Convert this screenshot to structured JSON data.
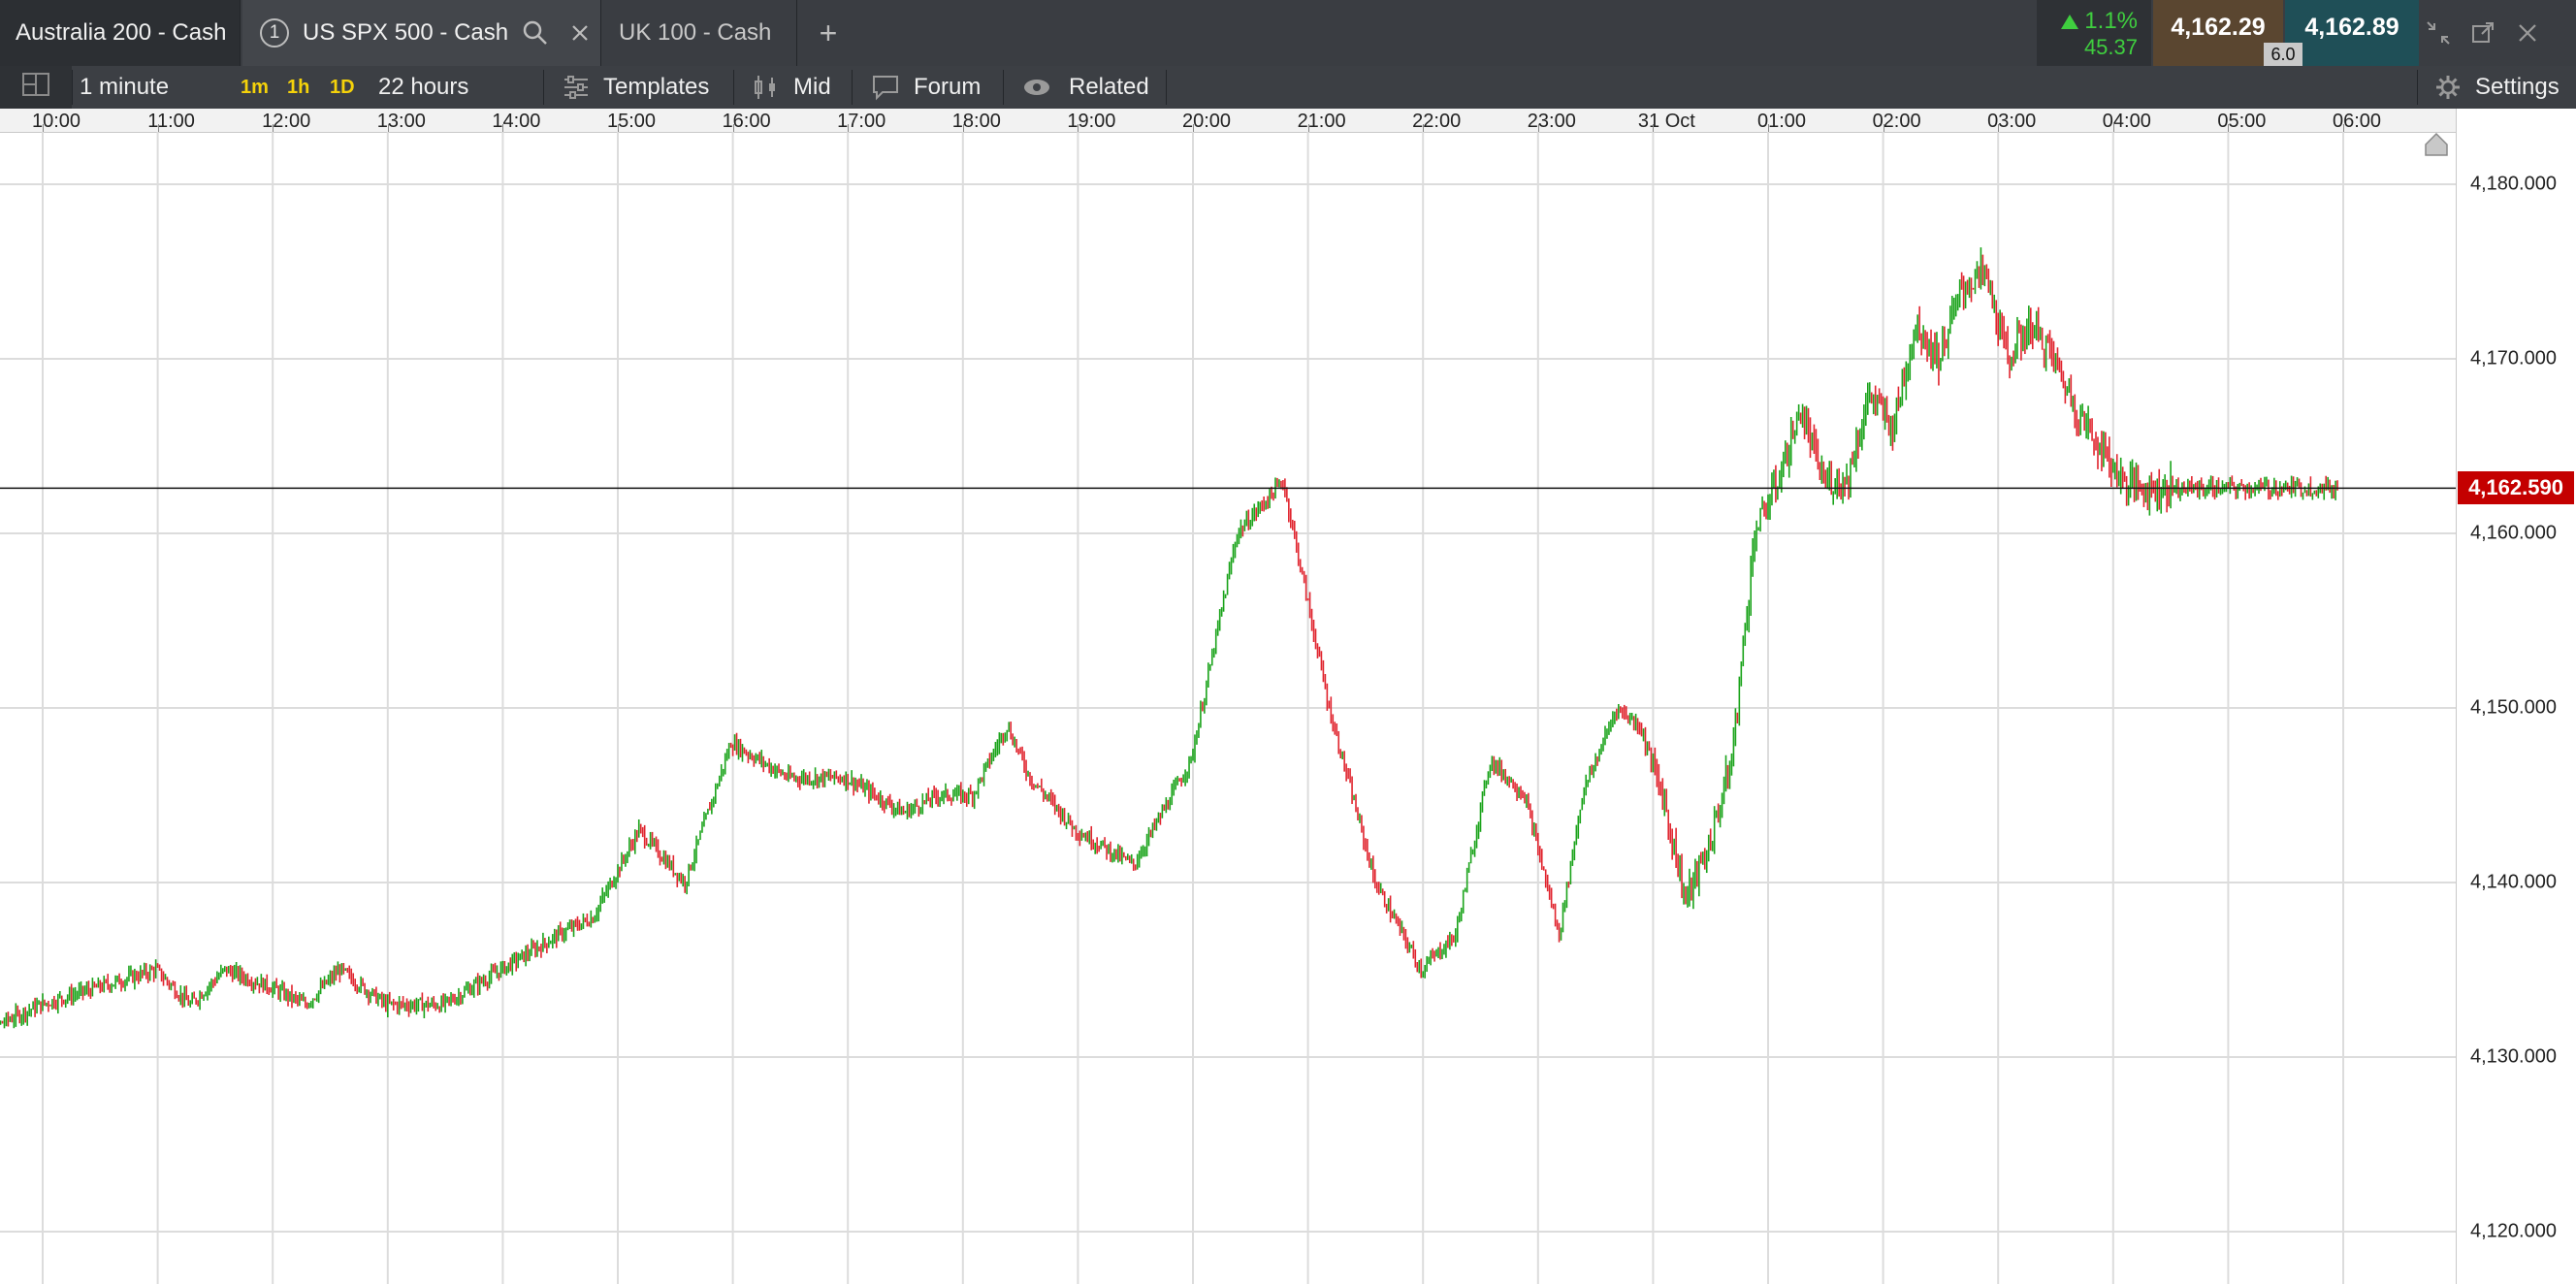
{
  "tabs": [
    {
      "label": "Australia 200 - Cash"
    },
    {
      "label": "US SPX 500 - Cash",
      "number": "1"
    },
    {
      "label": "UK 100 - Cash"
    }
  ],
  "add_tab_label": "+",
  "quote": {
    "change_pct": "1.1%",
    "change_abs": "45.37",
    "sell": "4,162.29",
    "buy": "4,162.89",
    "spread": "6.0",
    "colors": {
      "up": "#3fce3f",
      "sell_bg": "#5a4630",
      "buy_bg": "#1f4f57",
      "current_price_bg": "#c40000"
    }
  },
  "toolbar": {
    "interval": "1 minute",
    "tf_1m": "1m",
    "tf_1h": "1h",
    "tf_1d": "1D",
    "range": "22 hours",
    "templates": "Templates",
    "price_type": "Mid",
    "forum": "Forum",
    "related": "Related",
    "settings": "Settings"
  },
  "icons": [
    "layout-icon",
    "search-icon",
    "close-icon",
    "templates-icon",
    "candlestick-icon",
    "chat-icon",
    "eye-icon",
    "gear-icon",
    "collapse-icon",
    "popout-icon",
    "close-window-icon"
  ],
  "chart_data": {
    "type": "line",
    "style": "candlestick",
    "x_labels": [
      "10:00",
      "11:00",
      "12:00",
      "13:00",
      "14:00",
      "15:00",
      "16:00",
      "17:00",
      "18:00",
      "19:00",
      "20:00",
      "21:00",
      "22:00",
      "23:00",
      "31 Oct",
      "01:00",
      "02:00",
      "03:00",
      "04:00",
      "05:00",
      "06:00"
    ],
    "y_tick_labels": [
      "4,180.000",
      "4,170.000",
      "4,160.000",
      "4,150.000",
      "4,140.000",
      "4,130.000",
      "4,120.000"
    ],
    "y_ticks": [
      4180,
      4170,
      4160,
      4150,
      4140,
      4130,
      4120
    ],
    "ylim": [
      4117,
      4183
    ],
    "current_price": 4162.59,
    "current_price_label": "4,162.590",
    "grid": true,
    "up_color": "#1aa31a",
    "down_color": "#e0242e",
    "x_hours": [
      9.35,
      10.0,
      10.5,
      11.0,
      11.3,
      11.6,
      12.0,
      12.3,
      12.6,
      13.0,
      13.5,
      14.0,
      14.5,
      14.8,
      15.2,
      15.6,
      16.0,
      16.5,
      17.0,
      17.5,
      17.8,
      18.1,
      18.4,
      18.6,
      19.0,
      19.5,
      20.0,
      20.4,
      20.8,
      21.2,
      21.6,
      22.0,
      22.3,
      22.6,
      22.9,
      23.2,
      23.4,
      23.7,
      23.9,
      24.1,
      24.3,
      24.5,
      24.7,
      24.9,
      25.1,
      25.3,
      25.5,
      25.7,
      25.9,
      26.1,
      26.3,
      26.5,
      26.7,
      26.9,
      27.1,
      27.3,
      27.5,
      27.7,
      27.9,
      28.1,
      28.3,
      28.5,
      28.7,
      28.9,
      29.1,
      29.3,
      29.5,
      29.7,
      29.95
    ],
    "values": [
      4131,
      4133,
      4134,
      4135,
      4133,
      4135,
      4134,
      4133,
      4135,
      4133,
      4133,
      4135,
      4137,
      4138,
      4143,
      4140,
      4148,
      4146,
      4146,
      4144,
      4145,
      4145,
      4149,
      4146,
      4143,
      4141,
      4147,
      4160,
      4163,
      4150,
      4140,
      4135,
      4137,
      4147,
      4145,
      4137,
      4145,
      4150,
      4149,
      4145,
      4139,
      4142,
      4147,
      4160,
      4163,
      4167,
      4163,
      4163,
      4168,
      4166,
      4172,
      4170,
      4174,
      4175,
      4170,
      4172,
      4170,
      4167,
      4165,
      4163,
      4162.6,
      4162.6,
      4162.6,
      4162.6,
      4162.6,
      4162.6,
      4162.6,
      4162.6,
      4162.6
    ]
  }
}
